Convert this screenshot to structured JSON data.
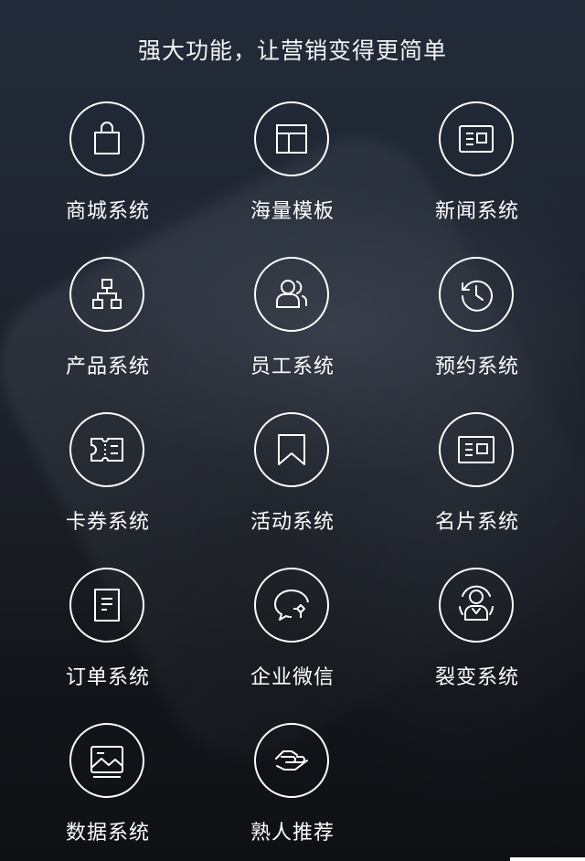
{
  "page": {
    "title": "强大功能，让营销变得更简单"
  },
  "features": [
    {
      "label": "商城系统",
      "icon": "shopping-bag-icon"
    },
    {
      "label": "海量模板",
      "icon": "template-layout-icon"
    },
    {
      "label": "新闻系统",
      "icon": "news-card-icon"
    },
    {
      "label": "产品系统",
      "icon": "product-tree-icon"
    },
    {
      "label": "员工系统",
      "icon": "employee-group-icon"
    },
    {
      "label": "预约系统",
      "icon": "history-clock-icon"
    },
    {
      "label": "卡券系统",
      "icon": "coupon-ticket-icon"
    },
    {
      "label": "活动系统",
      "icon": "activity-bookmark-icon"
    },
    {
      "label": "名片系统",
      "icon": "business-card-icon"
    },
    {
      "label": "订单系统",
      "icon": "order-document-icon"
    },
    {
      "label": "企业微信",
      "icon": "wecom-chat-icon"
    },
    {
      "label": "裂变系统",
      "icon": "fission-user-icon"
    },
    {
      "label": "数据系统",
      "icon": "data-picture-icon"
    },
    {
      "label": "熟人推荐",
      "icon": "handshake-icon"
    }
  ]
}
